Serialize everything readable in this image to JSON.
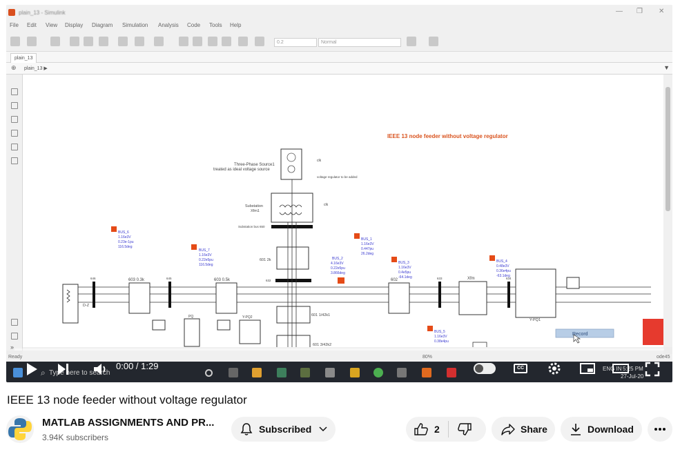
{
  "video": {
    "window": {
      "title": "plain_13 - Simulink",
      "menu": [
        "File",
        "Edit",
        "View",
        "Display",
        "Diagram",
        "Simulation",
        "Analysis",
        "Code",
        "Tools",
        "Help"
      ],
      "sim_time": "0.2",
      "sim_mode": "Normal",
      "tab_label": "plain_13",
      "breadcrumb": "plain_13 ▶",
      "status_ready": "Ready",
      "zoom": "80%",
      "right_status": "ode45"
    },
    "diagram": {
      "title": "IEEE 13 node feeder without voltage regulator",
      "source_label": "Three-Phase Source1",
      "source_label2": "treated as ideal voltage source",
      "vreg_note": "voltage regulator to be added",
      "substation_label": "Substation",
      "substation_label2": "Xfm1",
      "substation_bus": "Substation bus 650",
      "clk": "clk",
      "buses": {
        "bus6": [
          "BUS_6",
          "1.16e3V",
          "0.23e-1pu",
          "116.5deg"
        ],
        "bus7": [
          "BUS_7",
          "1.16e3V",
          "0.22e5pu",
          "116.5deg"
        ],
        "bus1": [
          "BUS_1",
          "1.16e3V",
          "0.447pu",
          "26.2deg"
        ],
        "bus2": [
          "BUS_2",
          "4.16e3V",
          "0.22e5pu",
          "3.866deg"
        ],
        "bus3": [
          "BUS_3",
          "1.16e3V",
          "0.4e5pu",
          "-64.1deg"
        ],
        "bus4": [
          "BUS_4",
          "0.48e3V",
          "0.36e4pu",
          "-63.1deg"
        ],
        "bus5": [
          "BUS_5",
          "1.16e3V",
          "0.38e4pu"
        ]
      },
      "blocks": {
        "line_603_03": "603 0.3k",
        "line_603_05": "603 0.5k",
        "line_601_2k": "601 2k",
        "line_601_1_42k": "601 1/42k1",
        "line_601_3_42k": "601 3/42k2",
        "line_602": "602",
        "xfm": "Xfm",
        "ypq": "Y-PQ2",
        "ypq1": "Y-PQ1",
        "pq": "PQ",
        "load_d": "D-Z",
        "node_645": "645",
        "node_646": "646",
        "node_633": "633",
        "node_632": "632",
        "node_634": "634",
        "record": "Record"
      }
    },
    "taskbar": {
      "search_placeholder": "Type here to search",
      "clock_time": "5:25 PM",
      "clock_date": "27-Jul-20",
      "lang": "ENG IN"
    },
    "player": {
      "time": "0:00 / 1:29",
      "progress_fraction": 0.0,
      "cc_label": "CC"
    }
  },
  "title": "IEEE 13 node feeder without voltage regulator",
  "channel": {
    "name": "MATLAB ASSIGNMENTS AND PR...",
    "subscribers": "3.94K subscribers"
  },
  "actions": {
    "subscribed_label": "Subscribed",
    "like_count": "2",
    "share_label": "Share",
    "download_label": "Download"
  },
  "colors": {
    "accent_red": "#ff0000",
    "diagram_title": "#d9531e",
    "bus_text": "#3a3ad0",
    "taskbar": "#23272e"
  }
}
